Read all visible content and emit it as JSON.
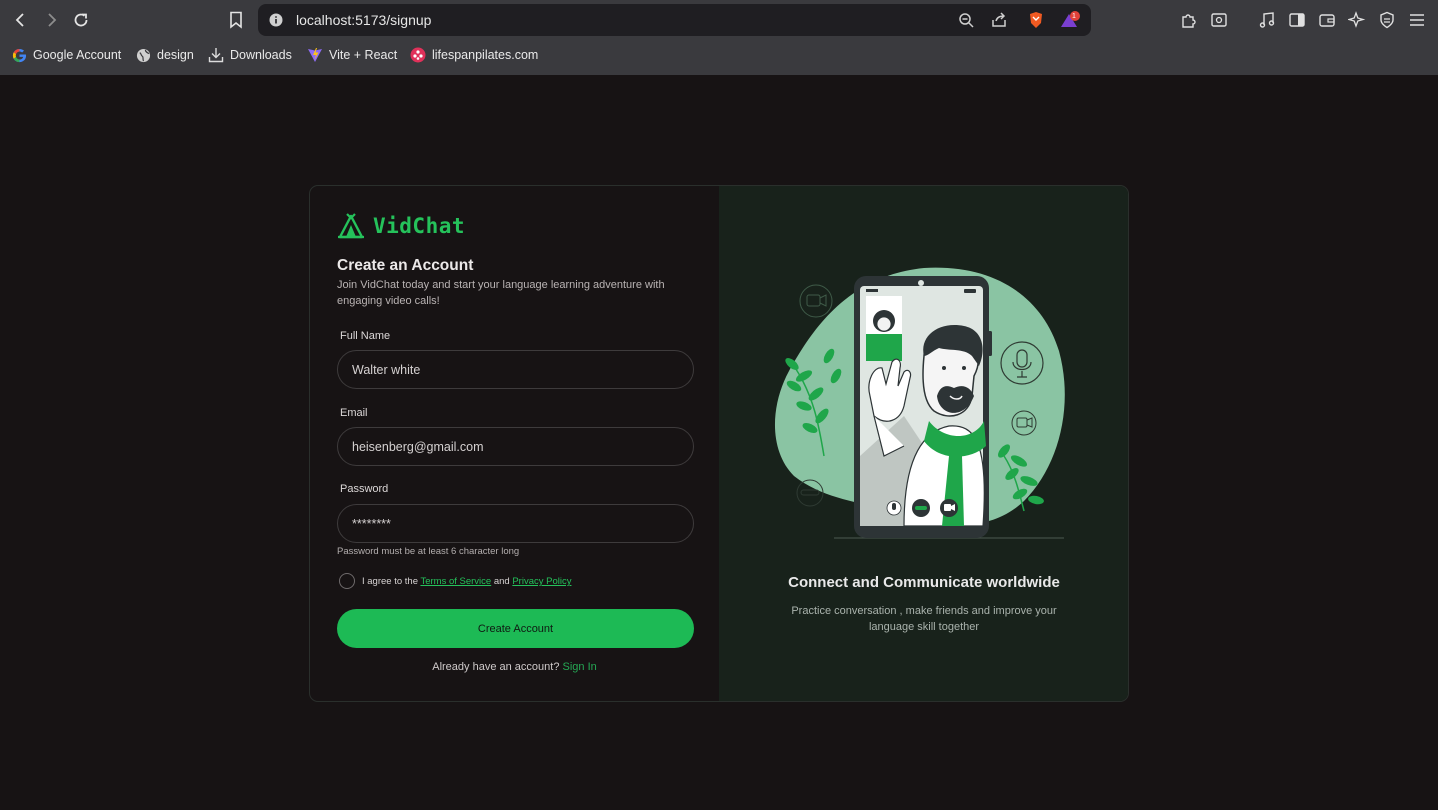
{
  "browser": {
    "url": "localhost:5173/signup",
    "notification_count": "1",
    "bookmarks": [
      {
        "label": "Google Account",
        "icon": "google-icon"
      },
      {
        "label": "design",
        "icon": "globe-icon"
      },
      {
        "label": "Downloads",
        "icon": "download-icon"
      },
      {
        "label": "Vite + React",
        "icon": "vite-icon"
      },
      {
        "label": "lifespanpilates.com",
        "icon": "site-icon"
      }
    ]
  },
  "brand": {
    "name": "VidChat",
    "accent": "#25c25b"
  },
  "form": {
    "title": "Create an Account",
    "subtitle": "Join VidChat today and start your language learning adventure with engaging video calls!",
    "full_name_label": "Full Name",
    "full_name_value": "Walter white",
    "email_label": "Email",
    "email_value": "heisenberg@gmail.com",
    "password_label": "Password",
    "password_value": "********",
    "password_hint": "Password must be at least 6 character long",
    "agree_prefix": "I agree to the",
    "terms_link": "Terms of Service",
    "agree_and": "and",
    "privacy_link": "Privacy Policy",
    "submit_label": "Create Account",
    "signin_prompt": "Already have an account?",
    "signin_link": "Sign In"
  },
  "promo": {
    "headline": "Connect and Communicate worldwide",
    "tagline": "Practice conversation , make friends and improve your language skill together"
  }
}
